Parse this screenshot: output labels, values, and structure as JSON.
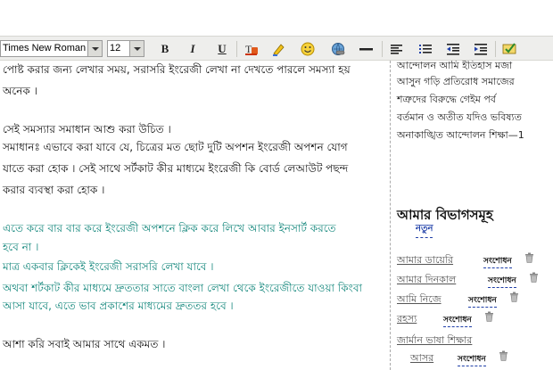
{
  "toolbar": {
    "font_family": "Times New Roman",
    "font_size": "12",
    "bold_label": "B",
    "italic_label": "I",
    "underline_label": "U",
    "icons": [
      "font-color-icon",
      "highlight-icon",
      "smiley-icon",
      "insert-link-icon",
      "horizontal-rule-icon",
      "align-left-icon",
      "bulleted-list-icon",
      "outdent-icon",
      "indent-icon",
      "spellcheck-icon"
    ]
  },
  "editor": {
    "lines": [
      {
        "text": "পোষ্ট করার জন্য লেখার সময়, সরাসরি ইংরেজী লেখা না দেখতে পারলে সমস্যা হয়",
        "style": "normal"
      },
      {
        "text": "অনেক ।",
        "style": "normal"
      },
      {
        "text": "সেই সমস্যার সমাধান আশু করা উচিত ।",
        "style": "normal"
      },
      {
        "text": "সমাধানঃ এভাবে করা যাবে যে, চিত্রের মত ছোট দুটি অপশন ইংরেজী অপশন যোগ",
        "style": "normal"
      },
      {
        "text": "যাতে করা হোক । সেই সাথে সর্টকাট কীর মাধ্যমে ইংরেজী কি বোর্ড লেআউট পছন্দ",
        "style": "normal"
      },
      {
        "text": "করার ব্যবস্থা করা হোক ।",
        "style": "normal"
      },
      {
        "text": "এতে করে বার বার করে ইংরেজী অপশনে ক্লিক করে লিখে আবার ইনসার্ট করতে",
        "style": "teal"
      },
      {
        "text": "হবে না ।",
        "style": "teal"
      },
      {
        "text": "মাত্র একবার ক্লিকেই ইংরেজী সরাসরি লেখা যাবে ।",
        "style": "teal"
      },
      {
        "text": "অথবা শর্টকাট কীর মাধ্যমে দ্রুততার সাতে বাংলা লেখা থেকে ইংরেজীতে যাওয়া কিংবা",
        "style": "teal"
      },
      {
        "text": "আসা যাবে, এতে ভাব প্রকাশের মাধ্যমের দ্রুততর হবে ।",
        "style": "teal"
      },
      {
        "text": "আশা করি সবাই আমার সাথে একমত ।",
        "style": "normal"
      }
    ]
  },
  "sidebar": {
    "tag_lines": [
      "আন্দোলন আমি ইতিহাস মজা",
      "আসুন গড়ি প্রতিরোধ সমাজের",
      "শত্রুদের বিরুদ্ধে গেইম পর্ব",
      "বর্তমান ও অতীত যদিও ভবিষ্যত",
      "অনাকাঙ্খিত আন্দোলন শিক্ষা—1"
    ],
    "categories_title": "আমার বিভাগসমূহ",
    "new_label": "নতুন",
    "edit_label": "সংশোধন",
    "categories": [
      {
        "name": "আমার ডায়েরি"
      },
      {
        "name": "আমার দিনকাল"
      },
      {
        "name": "আমি নিজে"
      },
      {
        "name": "রহস্য"
      },
      {
        "name": "জার্মান ভাষা শিক্ষার"
      },
      {
        "name": "আসর"
      }
    ]
  },
  "colors": {
    "teal_text": "#10857a",
    "link_blue": "#1f3fa8",
    "toolbar_bg": "#eeeeec"
  }
}
